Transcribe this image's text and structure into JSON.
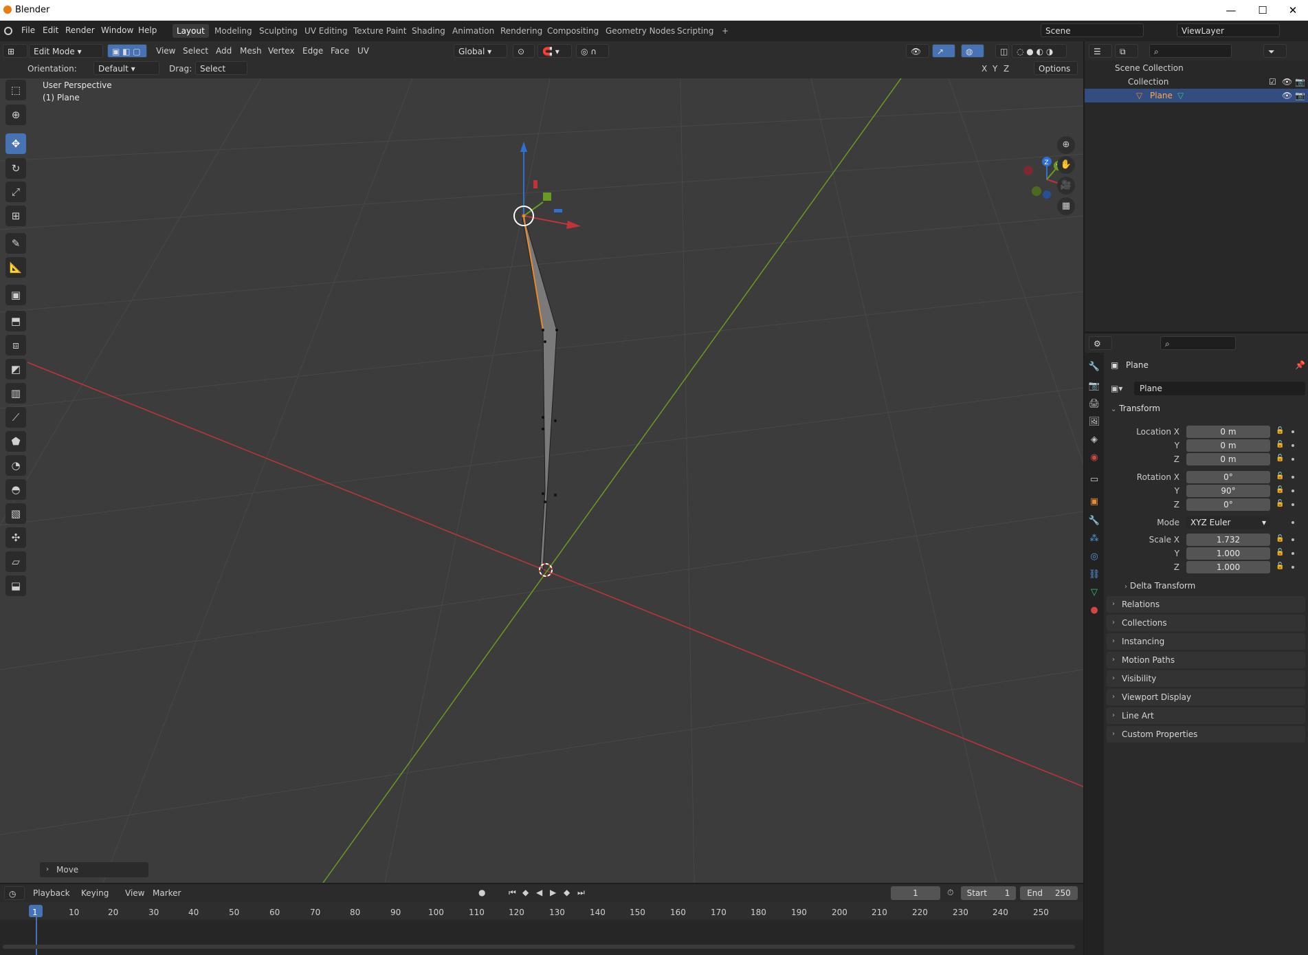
{
  "window": {
    "app_name": "Blender",
    "minimize": "—",
    "maximize": "☐",
    "close": "✕"
  },
  "menu": {
    "file": "File",
    "edit": "Edit",
    "render": "Render",
    "window": "Window",
    "help": "Help"
  },
  "workspaces": [
    "Layout",
    "Modeling",
    "Sculpting",
    "UV Editing",
    "Texture Paint",
    "Shading",
    "Animation",
    "Rendering",
    "Compositing",
    "Geometry Nodes",
    "Scripting"
  ],
  "add_workspace": "+",
  "scene": {
    "name": "Scene",
    "view_layer": "ViewLayer"
  },
  "viewport_header": {
    "mode": "Edit Mode",
    "view": "View",
    "select": "Select",
    "add": "Add",
    "mesh": "Mesh",
    "vertex": "Vertex",
    "edge": "Edge",
    "face": "Face",
    "uv": "UV",
    "transform": "Global"
  },
  "tool_header": {
    "orientation_label": "Orientation:",
    "orientation_value": "Default",
    "drag_label": "Drag:",
    "drag_value": "Select Box",
    "options": "Options",
    "x": "X",
    "y": "Y",
    "z": "Z"
  },
  "viewport": {
    "perspective": "User Perspective",
    "object": "(1) Plane",
    "last_op": "Move"
  },
  "gizmo": {
    "x": "X",
    "y": "Y",
    "z": "Z"
  },
  "outliner": {
    "scene_collection": "Scene Collection",
    "collection": "Collection",
    "object": "Plane"
  },
  "properties": {
    "object_name": "Plane",
    "object_field": "Plane",
    "transform": "Transform",
    "location": {
      "label_x": "Location X",
      "label_y": "Y",
      "label_z": "Z",
      "x": "0 m",
      "y": "0 m",
      "z": "0 m"
    },
    "rotation": {
      "label_x": "Rotation X",
      "label_y": "Y",
      "label_z": "Z",
      "x": "0°",
      "y": "90°",
      "z": "0°"
    },
    "mode_label": "Mode",
    "mode_value": "XYZ Euler",
    "scale": {
      "label_x": "Scale X",
      "label_y": "Y",
      "label_z": "Z",
      "x": "1.732",
      "y": "1.000",
      "z": "1.000"
    },
    "delta_transform": "Delta Transform",
    "panels": [
      "Relations",
      "Collections",
      "Instancing",
      "Motion Paths",
      "Visibility",
      "Viewport Display",
      "Line Art",
      "Custom Properties"
    ]
  },
  "timeline": {
    "playback": "Playback",
    "keying": "Keying",
    "view": "View",
    "marker": "Marker",
    "current_frame": "1",
    "start_label": "Start",
    "start": "1",
    "end_label": "End",
    "end": "250",
    "ticks": [
      "1",
      "10",
      "20",
      "30",
      "40",
      "50",
      "60",
      "70",
      "80",
      "90",
      "100",
      "110",
      "120",
      "130",
      "140",
      "150",
      "160",
      "170",
      "180",
      "190",
      "200",
      "210",
      "220",
      "230",
      "240",
      "250"
    ]
  },
  "colors": {
    "accent": "#4772b3",
    "x_axis": "#c0333d",
    "y_axis": "#6a9a23",
    "z_axis": "#2f6fd6",
    "selection": "#e88a2e"
  }
}
